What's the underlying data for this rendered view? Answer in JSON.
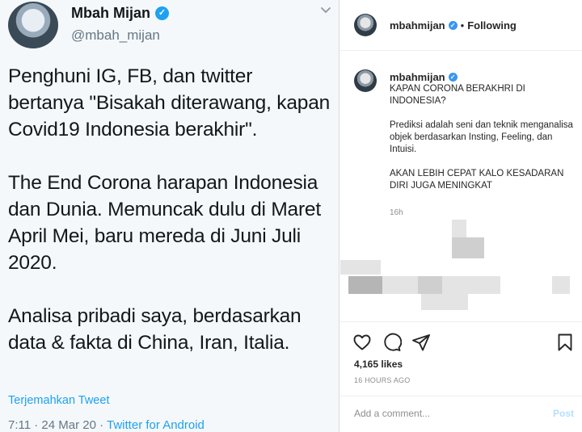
{
  "twitter": {
    "display_name": "Mbah Mijan",
    "handle": "@mbah_mijan",
    "body": "Penghuni IG, FB, dan twitter bertanya \"Bisakah diterawang, kapan Covid19 Indonesia berakhir\".\n\nThe End Corona harapan Indonesia dan Dunia. Memuncak dulu di Maret April Mei, baru mereda di Juni Juli 2020.\n\nAnalisa pribadi saya, berdasarkan data & fakta di China, Iran, Italia.",
    "translate_label": "Terjemahkan Tweet",
    "time": "7:11 · 24 Mar 20 · ",
    "source": "Twitter for Android",
    "accent_color": "#1da1f2"
  },
  "instagram": {
    "username": "mbahmijan",
    "header_separator": "•",
    "follow_status": "Following",
    "caption_username": "mbahmijan",
    "caption": "KAPAN CORONA BERAKHRI DI INDONESIA?\n\nPrediksi adalah seni dan teknik menganalisa objek berdasarkan Insting, Feeling, dan Intuisi.\n\nAKAN LEBIH CEPAT KALO KESADARAN DIRI JUGA MENINGKAT",
    "caption_time": "16h",
    "likes": "4,165 likes",
    "posted_ago": "16 HOURS AGO",
    "comment_placeholder": "Add a comment...",
    "post_label": "Post",
    "icons": [
      "heart-icon",
      "comment-icon",
      "share-icon",
      "bookmark-icon"
    ]
  }
}
